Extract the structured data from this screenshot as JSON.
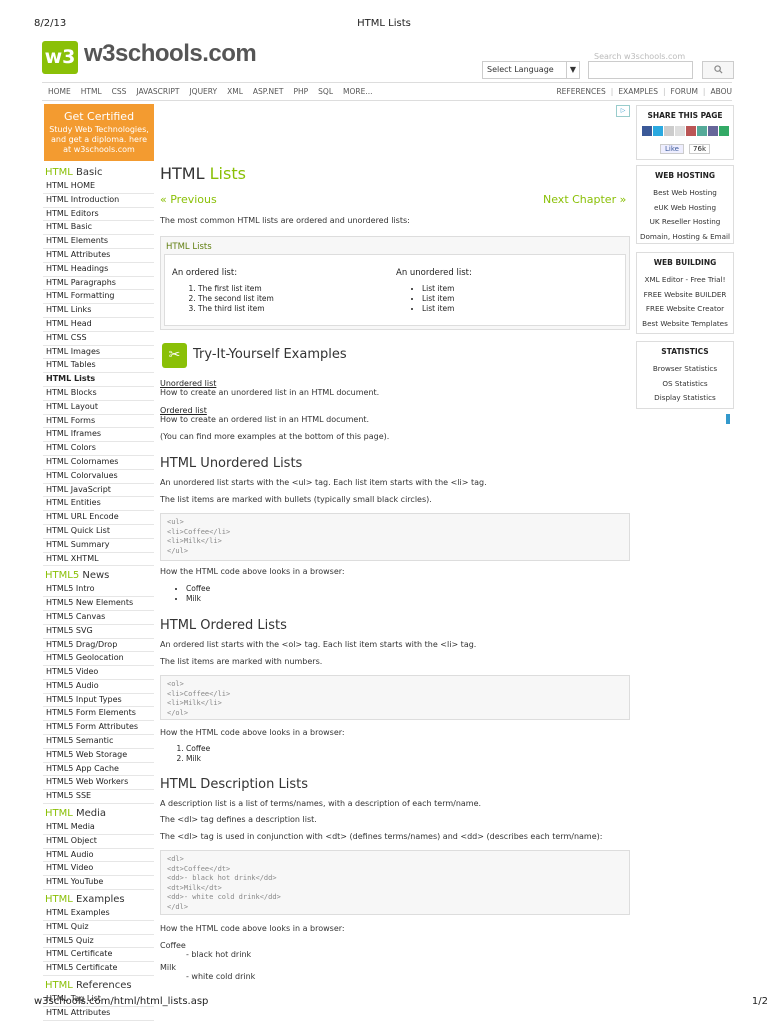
{
  "print": {
    "date": "8/2/13",
    "title": "HTML Lists",
    "url": "w3schools.com/html/html_lists.asp",
    "page": "1/2"
  },
  "header": {
    "logo_mark": "w3",
    "logo_text": "w3schools.com",
    "language_select": "Select Language",
    "language_arrow": "▼",
    "search_placeholder": "Search w3schools.com"
  },
  "topnav": {
    "left": [
      "HOME",
      "HTML",
      "CSS",
      "JAVASCRIPT",
      "JQUERY",
      "XML",
      "ASP.NET",
      "PHP",
      "SQL",
      "MORE..."
    ],
    "right": [
      "REFERENCES",
      "EXAMPLES",
      "FORUM",
      "ABOU"
    ]
  },
  "cert": {
    "title": "Get Certified",
    "text": "Study Web Technologies, and get a diploma. here at w3schools.com"
  },
  "sidebar": {
    "sections": [
      {
        "head": "HTML",
        "rest": "Basic",
        "items": [
          "HTML HOME",
          "HTML Introduction",
          "HTML Editors",
          "HTML Basic",
          "HTML Elements",
          "HTML Attributes",
          "HTML Headings",
          "HTML Paragraphs",
          "HTML Formatting",
          "HTML Links",
          "HTML Head",
          "HTML CSS",
          "HTML Images",
          "HTML Tables",
          "HTML Lists",
          "HTML Blocks",
          "HTML Layout",
          "HTML Forms",
          "HTML Iframes",
          "HTML Colors",
          "HTML Colornames",
          "HTML Colorvalues",
          "HTML JavaScript",
          "HTML Entities",
          "HTML URL Encode",
          "HTML Quick List",
          "HTML Summary",
          "HTML XHTML"
        ]
      },
      {
        "head": "HTML5",
        "rest": "News",
        "items": [
          "HTML5 Intro",
          "HTML5 New Elements",
          "HTML5 Canvas",
          "HTML5 SVG",
          "HTML5 Drag/Drop",
          "HTML5 Geolocation",
          "HTML5 Video",
          "HTML5 Audio",
          "HTML5 Input Types",
          "HTML5 Form Elements",
          "HTML5 Form Attributes",
          "HTML5 Semantic",
          "HTML5 Web Storage",
          "HTML5 App Cache",
          "HTML5 Web Workers",
          "HTML5 SSE"
        ]
      },
      {
        "head": "HTML",
        "rest": "Media",
        "items": [
          "HTML Media",
          "HTML Object",
          "HTML Audio",
          "HTML Video",
          "HTML YouTube"
        ]
      },
      {
        "head": "HTML",
        "rest": "Examples",
        "items": [
          "HTML Examples",
          "HTML Quiz",
          "HTML5 Quiz",
          "HTML Certificate",
          "HTML5 Certificate"
        ]
      },
      {
        "head": "HTML",
        "rest": "References",
        "items": [
          "HTML Tag List",
          "HTML Attributes"
        ]
      }
    ],
    "active": "HTML Lists"
  },
  "main": {
    "title_a": "HTML",
    "title_b": "Lists",
    "prev": "« Previous",
    "next": "Next Chapter »",
    "intro": "The most common HTML lists are ordered and unordered lists:",
    "example": {
      "title": "HTML Lists",
      "ordered_label": "An ordered list:",
      "ordered": [
        "The first list item",
        "The second list item",
        "The third list item"
      ],
      "unordered_label": "An unordered list:",
      "unordered": [
        "List item",
        "List item",
        "List item"
      ]
    },
    "tiy_icon": "✂",
    "tiy_title": "Try-It-Yourself Examples",
    "tiy_link1": "Unordered list",
    "tiy_desc1": "How to create an unordered list in an HTML document.",
    "tiy_link2": "Ordered list",
    "tiy_desc2": "How to create an ordered list in an HTML document.",
    "tiy_note": "(You can find more examples at the bottom of this page).",
    "ul_title": "HTML Unordered Lists",
    "ul_p1": "An unordered list starts with the <ul> tag. Each list item starts with the <li> tag.",
    "ul_p2": "The list items are marked with bullets (typically small black circles).",
    "ul_code": "<ul>\n<li>Coffee</li>\n<li>Milk</li>\n</ul>",
    "browser_note": "How the HTML code above looks in a browser:",
    "ul_render": [
      "Coffee",
      "Milk"
    ],
    "ol_title": "HTML Ordered Lists",
    "ol_p1": "An ordered list starts with the <ol> tag. Each list item starts with the <li> tag.",
    "ol_p2": "The list items are marked with numbers.",
    "ol_code": "<ol>\n<li>Coffee</li>\n<li>Milk</li>\n</ol>",
    "ol_render": [
      "Coffee",
      "Milk"
    ],
    "dl_title": "HTML Description Lists",
    "dl_p1": "A description list is a list of terms/names, with a description of each term/name.",
    "dl_p2": "The <dl> tag defines a description list.",
    "dl_p3": "The <dl> tag is used in conjunction with <dt> (defines terms/names) and <dd> (describes each term/name):",
    "dl_code": "<dl>\n<dt>Coffee</dt>\n<dd>- black hot drink</dd>\n<dt>Milk</dt>\n<dd>- white cold drink</dd>\n</dl>",
    "dl_render": [
      {
        "dt": "Coffee",
        "dd": "- black hot drink"
      },
      {
        "dt": "Milk",
        "dd": "- white cold drink"
      }
    ]
  },
  "right": {
    "ad_mark": "▷",
    "share": {
      "title": "SHARE THIS PAGE",
      "like": "Like",
      "count": "76k"
    },
    "hosting": {
      "title": "WEB HOSTING",
      "items": [
        "Best Web Hosting",
        "eUK Web Hosting",
        "UK Reseller Hosting",
        "Domain, Hosting & Email"
      ]
    },
    "building": {
      "title": "WEB BUILDING",
      "items": [
        "XML Editor - Free Trial!",
        "FREE Website BUILDER",
        "FREE Website Creator",
        "Best Website Templates"
      ]
    },
    "stats": {
      "title": "STATISTICS",
      "items": [
        "Browser Statistics",
        "OS Statistics",
        "Display Statistics"
      ]
    }
  },
  "colors": {
    "accent": "#8ac007",
    "cert_bg": "#f39b30"
  }
}
